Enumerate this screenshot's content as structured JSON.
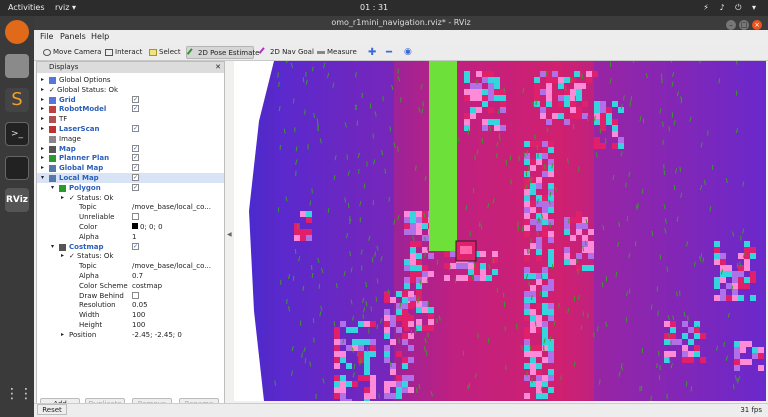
{
  "topbar": {
    "activities": "Activities",
    "app_menu": "rviz ▾",
    "clock": "01 : 31",
    "system_icons": "⚡ ♪ ⏻ ▾"
  },
  "window": {
    "title": "omo_r1mini_navigation.rviz* - RViz"
  },
  "menubar": {
    "file": "File",
    "panels": "Panels",
    "help": "Help"
  },
  "toolbar": {
    "move_camera": "Move Camera",
    "interact": "Interact",
    "select": "Select",
    "pose_estimate": "2D Pose Estimate",
    "nav_goal": "2D Nav Goal",
    "measure": "Measure"
  },
  "displays": {
    "header": "Displays",
    "rows": [
      {
        "label": "Global Options",
        "value": ""
      },
      {
        "label": "Global Status: Ok",
        "value": ""
      },
      {
        "label": "Grid",
        "value": "✓"
      },
      {
        "label": "RobotModel",
        "value": "✓"
      },
      {
        "label": "TF",
        "value": ""
      },
      {
        "label": "LaserScan",
        "value": "✓"
      },
      {
        "label": "Image",
        "value": ""
      },
      {
        "label": "Map",
        "value": "✓"
      },
      {
        "label": "Planner Plan",
        "value": "✓"
      },
      {
        "label": "Global Map",
        "value": "✓"
      },
      {
        "label": "Local Map",
        "value": "✓"
      },
      {
        "label": "Polygon",
        "value": "✓"
      },
      {
        "label": "Status: Ok",
        "value": ""
      },
      {
        "label": "Topic",
        "value": "/move_base/local_co..."
      },
      {
        "label": "Unreliable",
        "value": ""
      },
      {
        "label": "Color",
        "value": "0; 0; 0"
      },
      {
        "label": "Alpha",
        "value": "1"
      },
      {
        "label": "Costmap",
        "value": "✓"
      },
      {
        "label": "Status: Ok",
        "value": ""
      },
      {
        "label": "Topic",
        "value": "/move_base/local_co..."
      },
      {
        "label": "Alpha",
        "value": "0.7"
      },
      {
        "label": "Color Scheme",
        "value": "costmap"
      },
      {
        "label": "Draw Behind",
        "value": ""
      },
      {
        "label": "Resolution",
        "value": "0.05"
      },
      {
        "label": "Width",
        "value": "100"
      },
      {
        "label": "Height",
        "value": "100"
      },
      {
        "label": "Position",
        "value": "-2.45; -2.45; 0"
      }
    ]
  },
  "panel_buttons": {
    "add": "Add",
    "duplicate": "Duplicate",
    "remove": "Remove",
    "rename": "Rename"
  },
  "statusbar": {
    "reset": "Reset",
    "fps": "31 fps"
  },
  "colors": {
    "costmap_purple": "#7a1fb8",
    "costmap_magenta": "#e0206a",
    "costmap_cyan": "#35d5e0",
    "path_green": "#6ee03a",
    "accent": "#e95420"
  }
}
